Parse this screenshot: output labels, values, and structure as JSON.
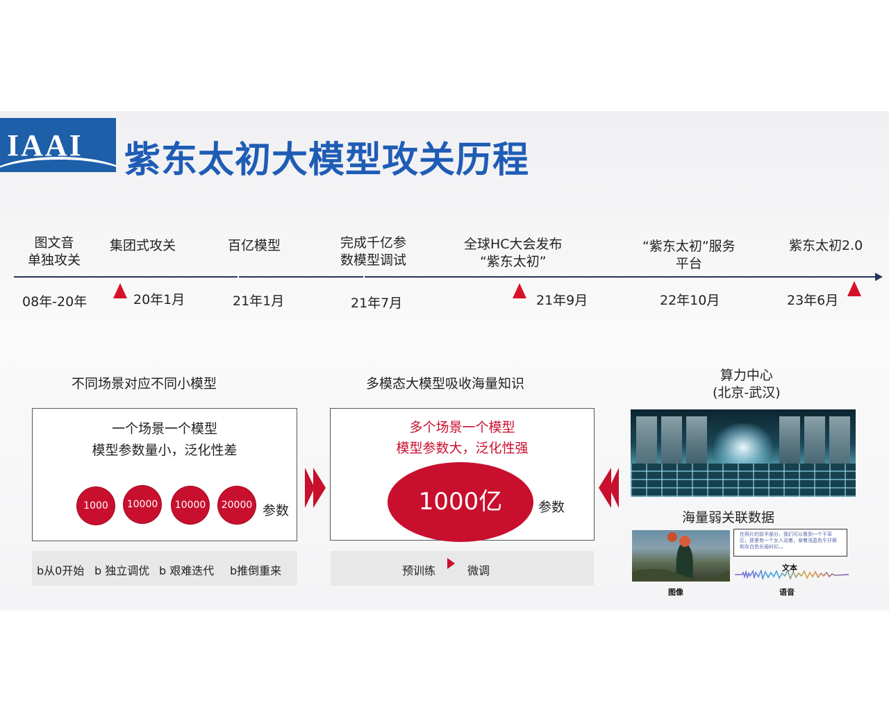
{
  "title": "紫东太初大模型攻关历程",
  "logo_text": "IAAI",
  "timeline": {
    "milestones": [
      {
        "label_lines": [
          "图文音",
          "单独攻关"
        ],
        "date": "08年-20年"
      },
      {
        "label_lines": [
          "集团式攻关"
        ],
        "date": "20年1月"
      },
      {
        "label_lines": [
          "百亿模型"
        ],
        "date": "21年1月"
      },
      {
        "label_lines": [
          "完成千亿参",
          "数模型调试"
        ],
        "date": "21年7月"
      },
      {
        "label_lines": [
          "全球HC大会发布",
          "“紫东太初”"
        ],
        "date": "21年9月"
      },
      {
        "label_lines": [
          "“紫东太初”服务",
          "平台"
        ],
        "date": "22年10月"
      },
      {
        "label_lines": [
          "紫东太初2.0"
        ],
        "date": "23年6月"
      }
    ]
  },
  "left_panel": {
    "heading": "不同场景对应不同小模型",
    "line1": "一个场景一个模型",
    "line2": "模型参数量小，泛化性差",
    "coins": [
      "1000",
      "10000",
      "10000",
      "20000"
    ],
    "unit": "参数",
    "bar_items": [
      {
        "bullet": "b",
        "text": "从0开始"
      },
      {
        "bullet": "b",
        "text": " 独立调优"
      },
      {
        "bullet": "b",
        "text": " 艰难迭代"
      },
      {
        "bullet": "b",
        "text": "推倒重来"
      }
    ]
  },
  "middle_panel": {
    "heading": "多模态大模型吸收海量知识",
    "line1": "多个场景一个模型",
    "line2": "模型参数大，泛化性强",
    "big_value": "1000亿",
    "unit": "参数",
    "bar_left": "预训练",
    "bar_right": "微调"
  },
  "right_panel": {
    "heading_line1": "算力中心",
    "heading_line2": "(北京-武汉)",
    "data_heading": "海量弱关联数据",
    "sample_text": "在照片的前半部分，我们可以看到一个干草区，那里有一个女人站着，穿着浅蓝色牛仔裤和灰白色长袖衬衫。。",
    "label_text": "文本",
    "label_image": "图像",
    "label_audio": "语音"
  },
  "colors": {
    "brand_blue": "#1f5cb5",
    "accent_red": "#c8102e",
    "axis": "#26345a"
  }
}
